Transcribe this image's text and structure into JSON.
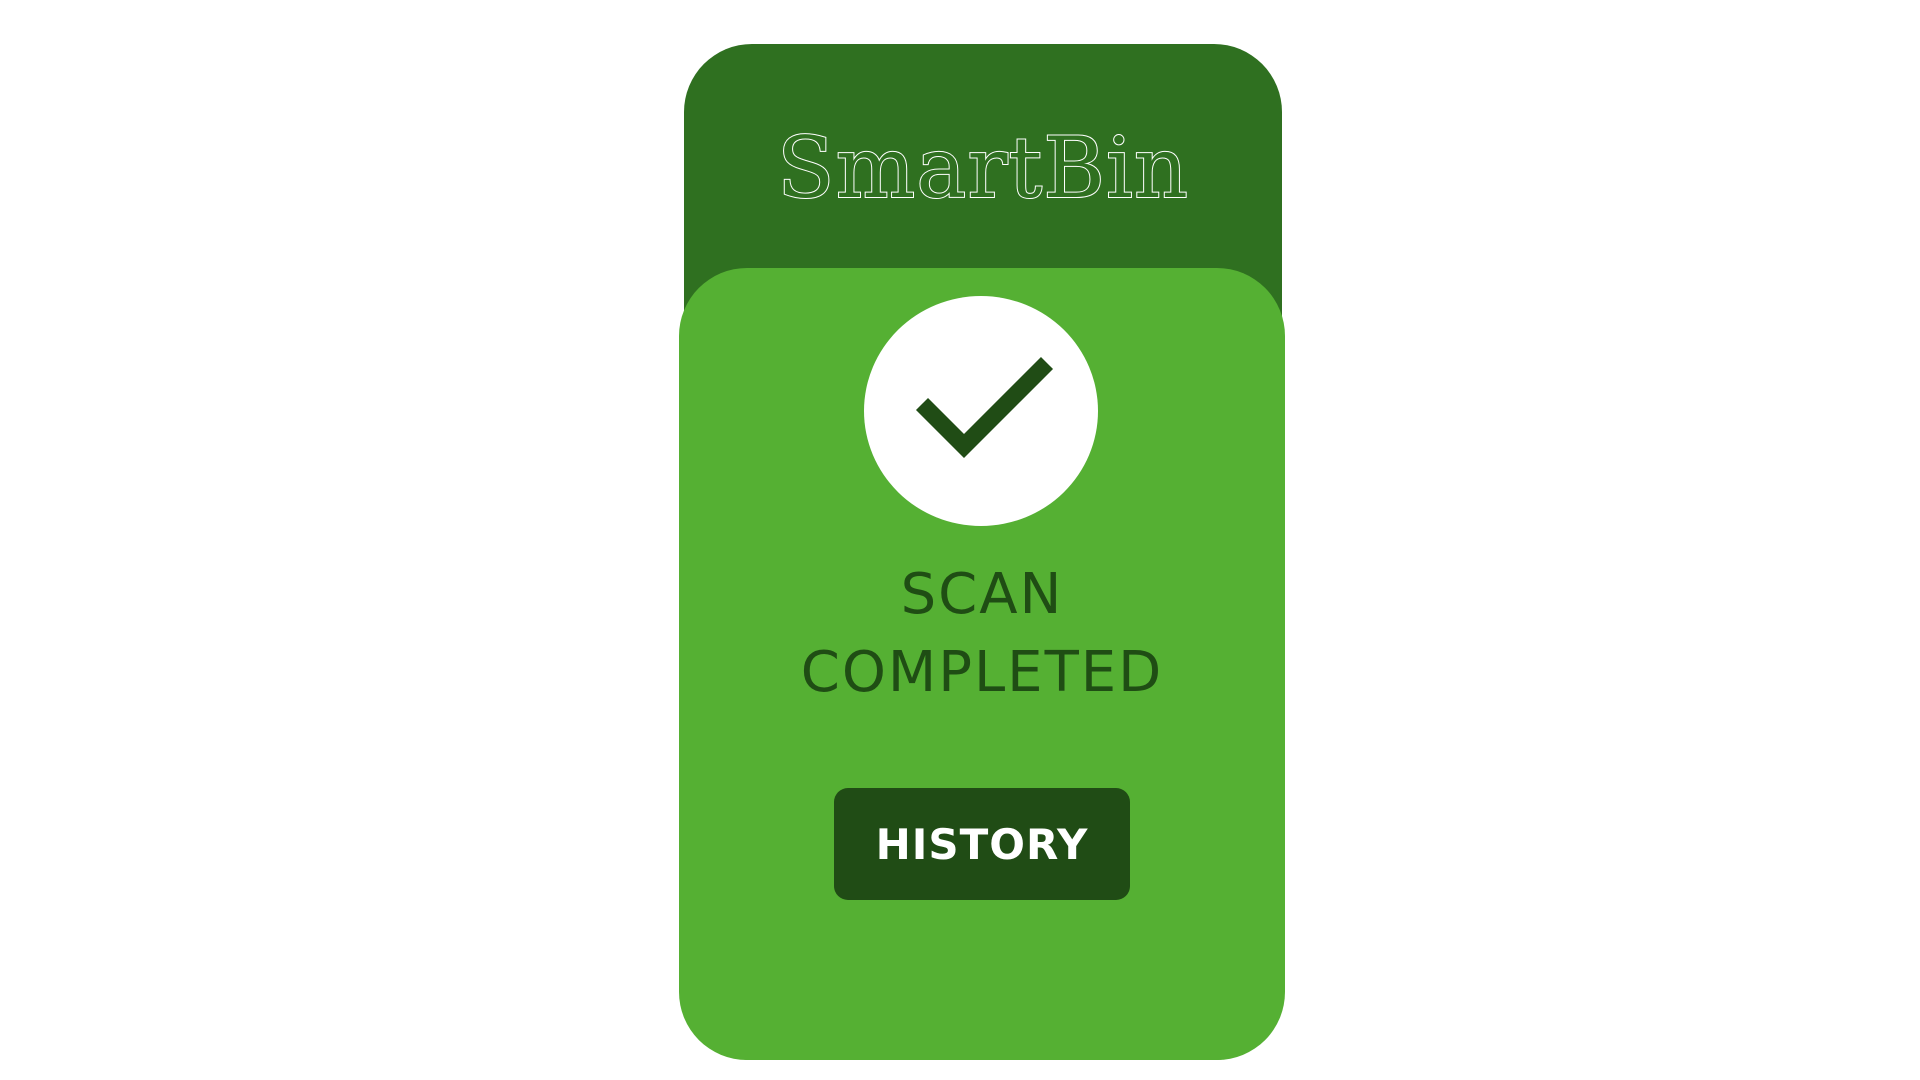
{
  "app": {
    "brand_name": "SmartBin"
  },
  "status": {
    "icon": "checkmark-icon",
    "line1": "SCAN",
    "line2": "COMPLETED"
  },
  "actions": {
    "history_label": "HISTORY"
  },
  "colors": {
    "background": "#ffffff",
    "header_green": "#2f7020",
    "card_green": "#55b033",
    "dark_green": "#204c15",
    "text_dark_green": "#1f4d14",
    "white": "#ffffff"
  }
}
